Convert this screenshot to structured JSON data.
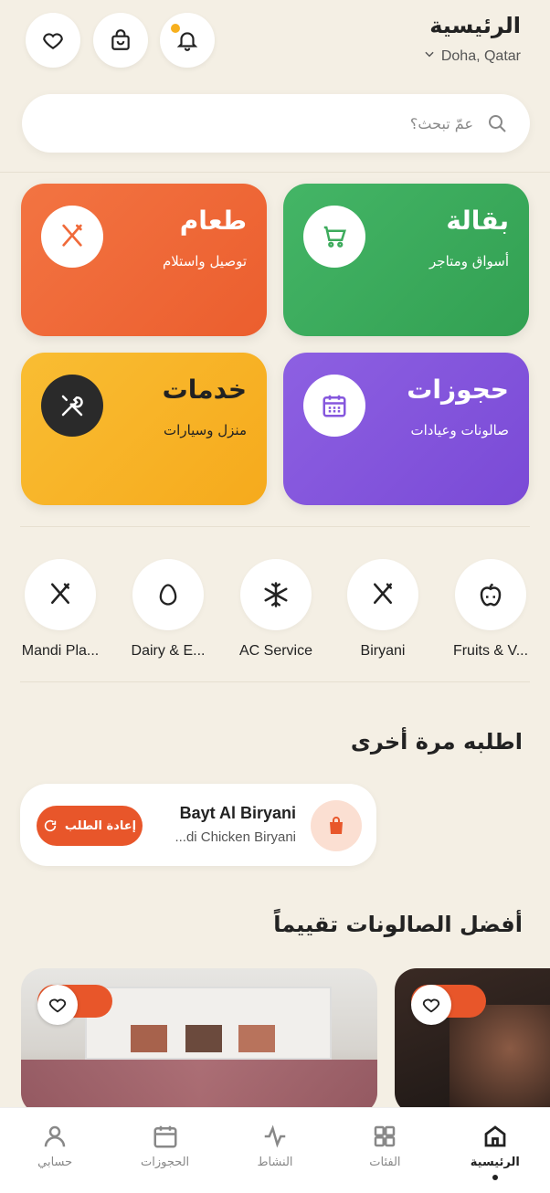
{
  "header": {
    "title": "الرئيسية",
    "location": "Doha, Qatar"
  },
  "search": {
    "placeholder": "عمّ تبحث؟"
  },
  "cards": [
    {
      "title": "بقالة",
      "subtitle": "أسواق ومتاجر",
      "color": "#3dab5c",
      "icon": "cart-icon"
    },
    {
      "title": "طعام",
      "subtitle": "توصيل واستلام",
      "color": "#f06a3a",
      "icon": "fork-knife-icon"
    },
    {
      "title": "حجوزات",
      "subtitle": "صالونات وعيادات",
      "color": "#8557dd",
      "icon": "calendar-icon"
    },
    {
      "title": "خدمات",
      "subtitle": "منزل وسيارات",
      "color": "#f8b52a",
      "icon": "tools-icon"
    }
  ],
  "quick_categories": [
    {
      "label": "Fruits & V...",
      "icon": "apple-icon"
    },
    {
      "label": "Biryani",
      "icon": "fork-knife-icon"
    },
    {
      "label": "AC Service",
      "icon": "snowflake-icon"
    },
    {
      "label": "Dairy & E...",
      "icon": "egg-icon"
    },
    {
      "label": "Mandi Pla...",
      "icon": "fork-knife-icon"
    }
  ],
  "reorder": {
    "section_title": "اطلبه مرة أخرى",
    "restaurant": "Bayt Al Biryani",
    "item": "...di Chicken Biryani",
    "button_label": "إعادة الطلب"
  },
  "salons": {
    "section_title": "أفضل الصالونات تقييماً"
  },
  "nav": {
    "items": [
      {
        "label": "الرئيسية",
        "icon": "home-icon",
        "active": true
      },
      {
        "label": "الفئات",
        "icon": "grid-icon"
      },
      {
        "label": "النشاط",
        "icon": "activity-icon"
      },
      {
        "label": "الحجوزات",
        "icon": "calendar-icon"
      },
      {
        "label": "حسابي",
        "icon": "user-icon"
      }
    ]
  },
  "colors": {
    "accent": "#e8562a",
    "background": "#f4efe4"
  }
}
